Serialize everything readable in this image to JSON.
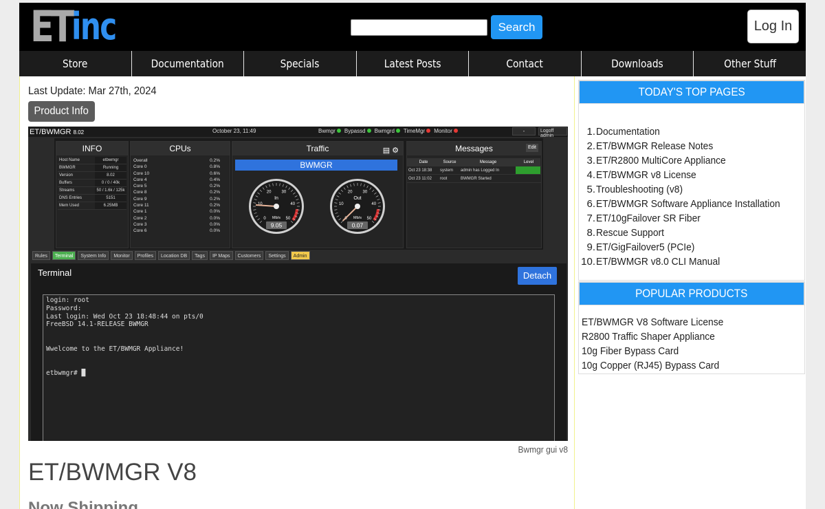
{
  "header": {
    "logo_et": "ET",
    "logo_inc": "inc",
    "search_placeholder": "",
    "search_button": "Search",
    "login_button": "Log In"
  },
  "nav": [
    "Store",
    "Documentation",
    "Specials",
    "Latest Posts",
    "Contact",
    "Downloads",
    "Other Stuff"
  ],
  "main": {
    "last_update": "Last Update: Mar 27th, 2024",
    "product_info_button": "Product Info",
    "image_caption": "Bwmgr gui v8",
    "product_title": "ET/BWMGR V8",
    "subheading": "Now Shipping"
  },
  "screenshot": {
    "title": "ET/BWMGR",
    "version": "8.02",
    "date": "October 23, 11:49",
    "status": [
      {
        "label": "Bwmgr",
        "color": "#3cc43c"
      },
      {
        "label": "Bypassd",
        "color": "#3cc43c"
      },
      {
        "label": "Bwmgrd",
        "color": "#3cc43c"
      },
      {
        "label": "TimeMgr",
        "color": "#e53935"
      },
      {
        "label": "Monitor",
        "color": "#e53935"
      }
    ],
    "minimize": "-",
    "logoff": "Logoff admin",
    "info_title": "INFO",
    "info": [
      [
        "Host Name",
        "etbwmgr"
      ],
      [
        "BWMGR",
        "Running"
      ],
      [
        "Version",
        "8.02"
      ],
      [
        "Buffers",
        "0 / 0 / 40k"
      ],
      [
        "Streams",
        "50 / 1.6k / 125k"
      ],
      [
        "DNS Entries",
        "5151"
      ],
      [
        "Mem Used",
        "6.25MB"
      ]
    ],
    "cpus_title": "CPUs",
    "cpus": [
      [
        "Overall",
        "0.2%"
      ],
      [
        "Core 0",
        "0.8%"
      ],
      [
        "Core 10",
        "0.6%"
      ],
      [
        "Core 4",
        "0.4%"
      ],
      [
        "Core 5",
        "0.2%"
      ],
      [
        "Core 8",
        "0.2%"
      ],
      [
        "Core 9",
        "0.2%"
      ],
      [
        "Core 11",
        "0.2%"
      ],
      [
        "Core 1",
        "0.0%"
      ],
      [
        "Core 2",
        "0.0%"
      ],
      [
        "Core 3",
        "0.0%"
      ],
      [
        "Core 6",
        "0.0%"
      ]
    ],
    "traffic_title": "Traffic",
    "traffic_bar": "BWMGR",
    "gauges": [
      {
        "label": "In",
        "unit": "Mb/s",
        "value": "9.05",
        "ticks": [
          "0",
          "10",
          "20",
          "30",
          "40",
          "50"
        ]
      },
      {
        "label": "Out",
        "unit": "Mb/s",
        "value": "0.07",
        "ticks": [
          "0",
          "10",
          "20",
          "30",
          "40",
          "50"
        ]
      }
    ],
    "messages_title": "Messages",
    "messages_edit": "Edit",
    "messages_header": [
      "Date",
      "Source",
      "Message",
      "Level"
    ],
    "messages": [
      [
        "Oct 23 18:38",
        "system",
        "admin has Logged In",
        ""
      ],
      [
        "Oct 23 11:02",
        "root",
        "BWMGR Started",
        ""
      ]
    ],
    "tabs": [
      "Rules",
      "Terminal",
      "System Info",
      "Monitor",
      "Profiles",
      "Location DB",
      "Tags",
      "IP Maps",
      "Customers",
      "Settings",
      "Admin"
    ],
    "terminal_title": "Terminal",
    "detach": "Detach",
    "terminal_text": "login: root\nPassword:\nLast login: Wed Oct 23 18:48:44 on pts/0\nFreeBSD 14.1-RELEASE BWMGR\n\n\nWwelcome to the ET/BWMGR Appliance!\n\n\netbwmgr# █"
  },
  "sidebar": {
    "top_pages_title": "TODAY'S TOP PAGES",
    "top_pages": [
      "Documentation",
      "ET/BWMGR Release Notes",
      "ET/R2800 MultiCore Appliance",
      "ET/BWMGR v8 License",
      "Troubleshooting (v8)",
      "ET/BWMGR Software Appliance Installation",
      "ET/10gFailover SR Fiber",
      "Rescue Support",
      "ET/GigFailover5 (PCIe)",
      "ET/BWMGR v8.0 CLI Manual"
    ],
    "popular_title": "POPULAR PRODUCTS",
    "popular": [
      "ET/BWMGR V8 Software License",
      "R2800 Traffic Shaper Appliance",
      "10g Fiber Bypass Card",
      "10g Copper (RJ45) Bypass Card"
    ]
  },
  "colors": {
    "accent": "#2196f3",
    "logo_gray": "#a9a9a9",
    "logo_blue": "#2f8ff0",
    "nav_bg": "#1c1c1c"
  }
}
